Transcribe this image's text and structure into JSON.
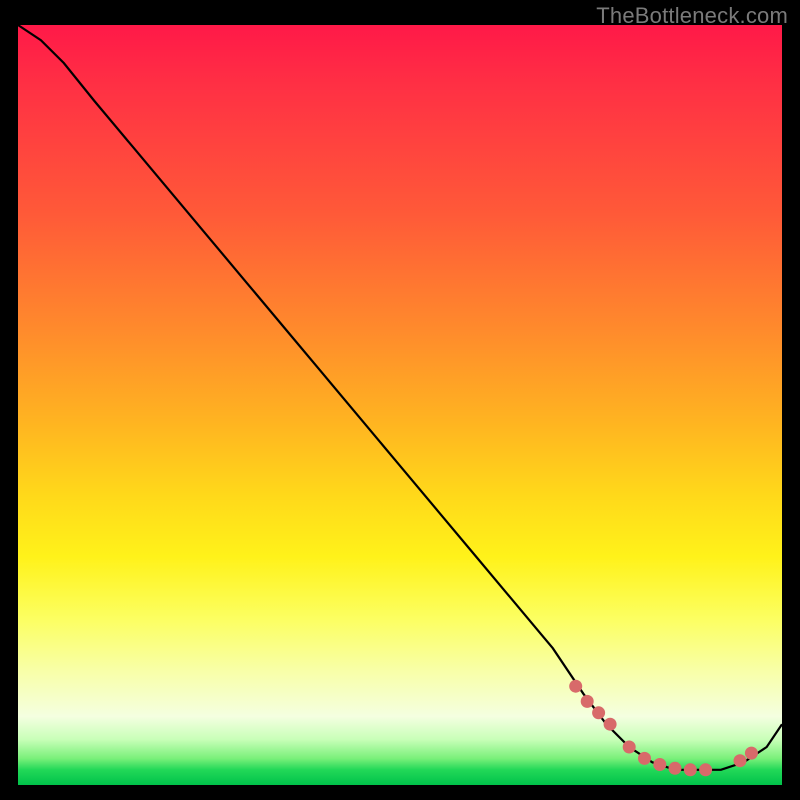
{
  "watermark": "TheBottleneck.com",
  "colors": {
    "background": "#000000",
    "gradient_top": "#ff1948",
    "gradient_mid": "#ffe01a",
    "gradient_bottom": "#00c24a",
    "curve": "#000000",
    "marker": "#d86a6a"
  },
  "chart_data": {
    "type": "line",
    "title": "",
    "xlabel": "",
    "ylabel": "",
    "xlim": [
      0,
      100
    ],
    "ylim": [
      0,
      100
    ],
    "grid": false,
    "legend": false,
    "series": [
      {
        "name": "bottleneck-curve",
        "x": [
          0,
          3,
          6,
          10,
          15,
          20,
          25,
          30,
          35,
          40,
          45,
          50,
          55,
          60,
          65,
          70,
          74,
          77,
          80,
          83,
          86,
          89,
          92,
          95,
          98,
          100
        ],
        "y": [
          100,
          98,
          95,
          90,
          84,
          78,
          72,
          66,
          60,
          54,
          48,
          42,
          36,
          30,
          24,
          18,
          12,
          8,
          5,
          3,
          2,
          2,
          2,
          3,
          5,
          8
        ]
      }
    ],
    "markers": {
      "name": "highlight-points",
      "x": [
        73,
        74.5,
        76,
        77.5,
        80,
        82,
        84,
        86,
        88,
        90,
        94.5,
        96
      ],
      "y": [
        13,
        11,
        9.5,
        8,
        5,
        3.5,
        2.7,
        2.2,
        2.0,
        2.0,
        3.2,
        4.2
      ]
    }
  }
}
